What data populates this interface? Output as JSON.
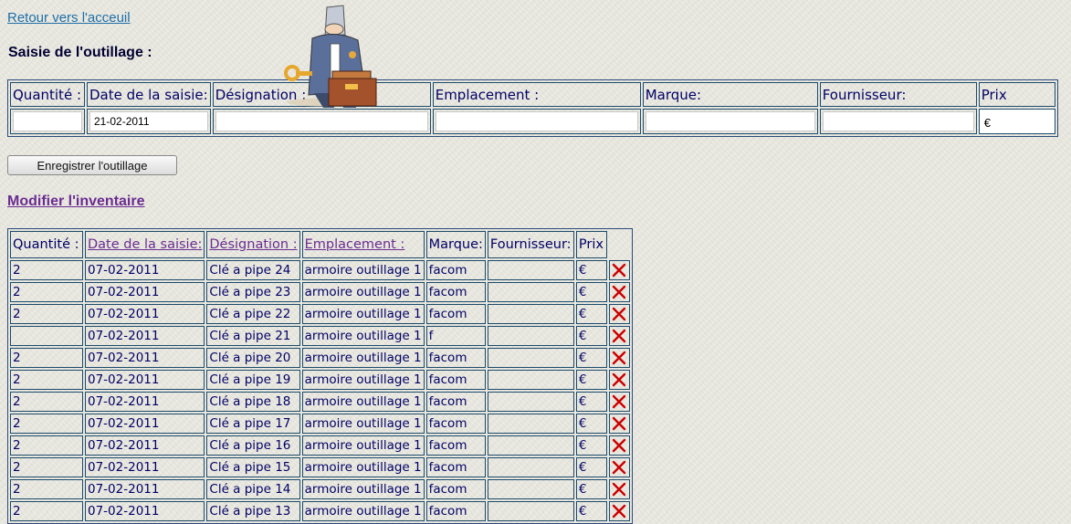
{
  "nav": {
    "home_link": "Retour vers l'acceuil"
  },
  "entry": {
    "title": "Saisie de l'outillage :",
    "headers": [
      "Quantité :",
      "Date de la saisie:",
      "Désignation :",
      "Emplacement :",
      "Marque:",
      "Fournisseur:",
      "Prix"
    ],
    "date_value": "21-02-2011",
    "price_symbol": "€",
    "save_button": "Enregistrer l'outillage"
  },
  "inventory": {
    "title": "Modifier l'inventaire",
    "headers": [
      "Quantité :",
      "Date de la saisie:",
      "Désignation :",
      "Emplacement :",
      "Marque:",
      "Fournisseur:",
      "Prix"
    ],
    "rows": [
      {
        "qty": "2",
        "date": "07-02-2011",
        "designation": "Clé a pipe 24",
        "location": "armoire outillage 1",
        "brand": "facom",
        "supplier": "",
        "price": "€"
      },
      {
        "qty": "2",
        "date": "07-02-2011",
        "designation": "Clé a pipe 23",
        "location": "armoire outillage 1",
        "brand": "facom",
        "supplier": "",
        "price": "€"
      },
      {
        "qty": "2",
        "date": "07-02-2011",
        "designation": "Clé a pipe 22",
        "location": "armoire outillage 1",
        "brand": "facom",
        "supplier": "",
        "price": "€"
      },
      {
        "qty": "",
        "date": "07-02-2011",
        "designation": "Clé a pipe 21",
        "location": "armoire outillage 1",
        "brand": "f",
        "supplier": "",
        "price": "€"
      },
      {
        "qty": "2",
        "date": "07-02-2011",
        "designation": "Clé a pipe 20",
        "location": "armoire outillage 1",
        "brand": "facom",
        "supplier": "",
        "price": "€"
      },
      {
        "qty": "2",
        "date": "07-02-2011",
        "designation": "Clé a pipe 19",
        "location": "armoire outillage 1",
        "brand": "facom",
        "supplier": "",
        "price": "€"
      },
      {
        "qty": "2",
        "date": "07-02-2011",
        "designation": "Clé a pipe 18",
        "location": "armoire outillage 1",
        "brand": "facom",
        "supplier": "",
        "price": "€"
      },
      {
        "qty": "2",
        "date": "07-02-2011",
        "designation": "Clé a pipe 17",
        "location": "armoire outillage 1",
        "brand": "facom",
        "supplier": "",
        "price": "€"
      },
      {
        "qty": "2",
        "date": "07-02-2011",
        "designation": "Clé a pipe 16",
        "location": "armoire outillage 1",
        "brand": "facom",
        "supplier": "",
        "price": "€"
      },
      {
        "qty": "2",
        "date": "07-02-2011",
        "designation": "Clé a pipe 15",
        "location": "armoire outillage 1",
        "brand": "facom",
        "supplier": "",
        "price": "€"
      },
      {
        "qty": "2",
        "date": "07-02-2011",
        "designation": "Clé a pipe 14",
        "location": "armoire outillage 1",
        "brand": "facom",
        "supplier": "",
        "price": "€"
      },
      {
        "qty": "2",
        "date": "07-02-2011",
        "designation": "Clé a pipe 13",
        "location": "armoire outillage 1",
        "brand": "facom",
        "supplier": "",
        "price": "€"
      }
    ],
    "delete_icon": "delete-x-icon",
    "delete_color": "#cc0000"
  }
}
